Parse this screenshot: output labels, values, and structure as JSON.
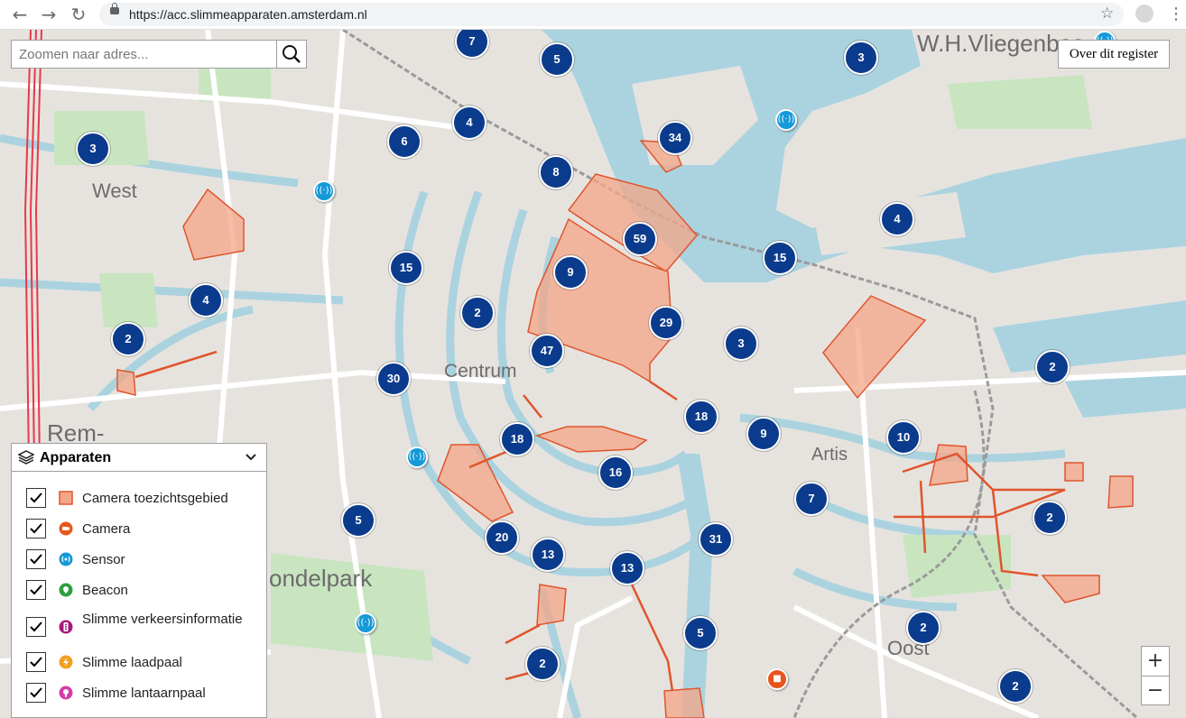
{
  "browser": {
    "url": "https://acc.slimmeapparaten.amsterdam.nl",
    "back_icon": "←",
    "forward_icon": "→",
    "reload_icon": "↻",
    "star_icon": "☆",
    "menu_icon": "⋮"
  },
  "search": {
    "placeholder": "Zoomen naar adres..."
  },
  "over_button": "Over dit register",
  "places": {
    "vliegenbos": "W.H.Vliegenbos",
    "west": "West",
    "centrum": "Centrum",
    "artis": "Artis",
    "rem": "Rem-",
    "vondelpark": "ondelpark",
    "oost": "Oost"
  },
  "clusters": [
    "7",
    "5",
    "3",
    "4",
    "6",
    "8",
    "34",
    "3",
    "4",
    "59",
    "15",
    "9",
    "15",
    "4",
    "2",
    "2",
    "29",
    "3",
    "47",
    "30",
    "2",
    "18",
    "9",
    "10",
    "18",
    "16",
    "7",
    "5",
    "20",
    "13",
    "13",
    "31",
    "2",
    "5",
    "2",
    "2",
    "2"
  ],
  "legend": {
    "title": "Apparaten",
    "items": [
      {
        "label": "Camera toezichtsgebied",
        "color": "#f4a688"
      },
      {
        "label": "Camera",
        "color": "#e8551c"
      },
      {
        "label": "Sensor",
        "color": "#1599d8"
      },
      {
        "label": "Beacon",
        "color": "#2e9e3e"
      },
      {
        "label": "Slimme verkeersinformatie",
        "color": "#a8197c"
      },
      {
        "label": "Slimme laadpaal",
        "color": "#f0a020"
      },
      {
        "label": "Slimme lantaarnpaal",
        "color": "#d63ca8"
      }
    ]
  },
  "zoom": {
    "in": "+",
    "out": "−"
  },
  "colors": {
    "cluster": "#0b3b8c",
    "water": "#aad3df",
    "area": "#f4a688",
    "map": "#e6e3df"
  }
}
